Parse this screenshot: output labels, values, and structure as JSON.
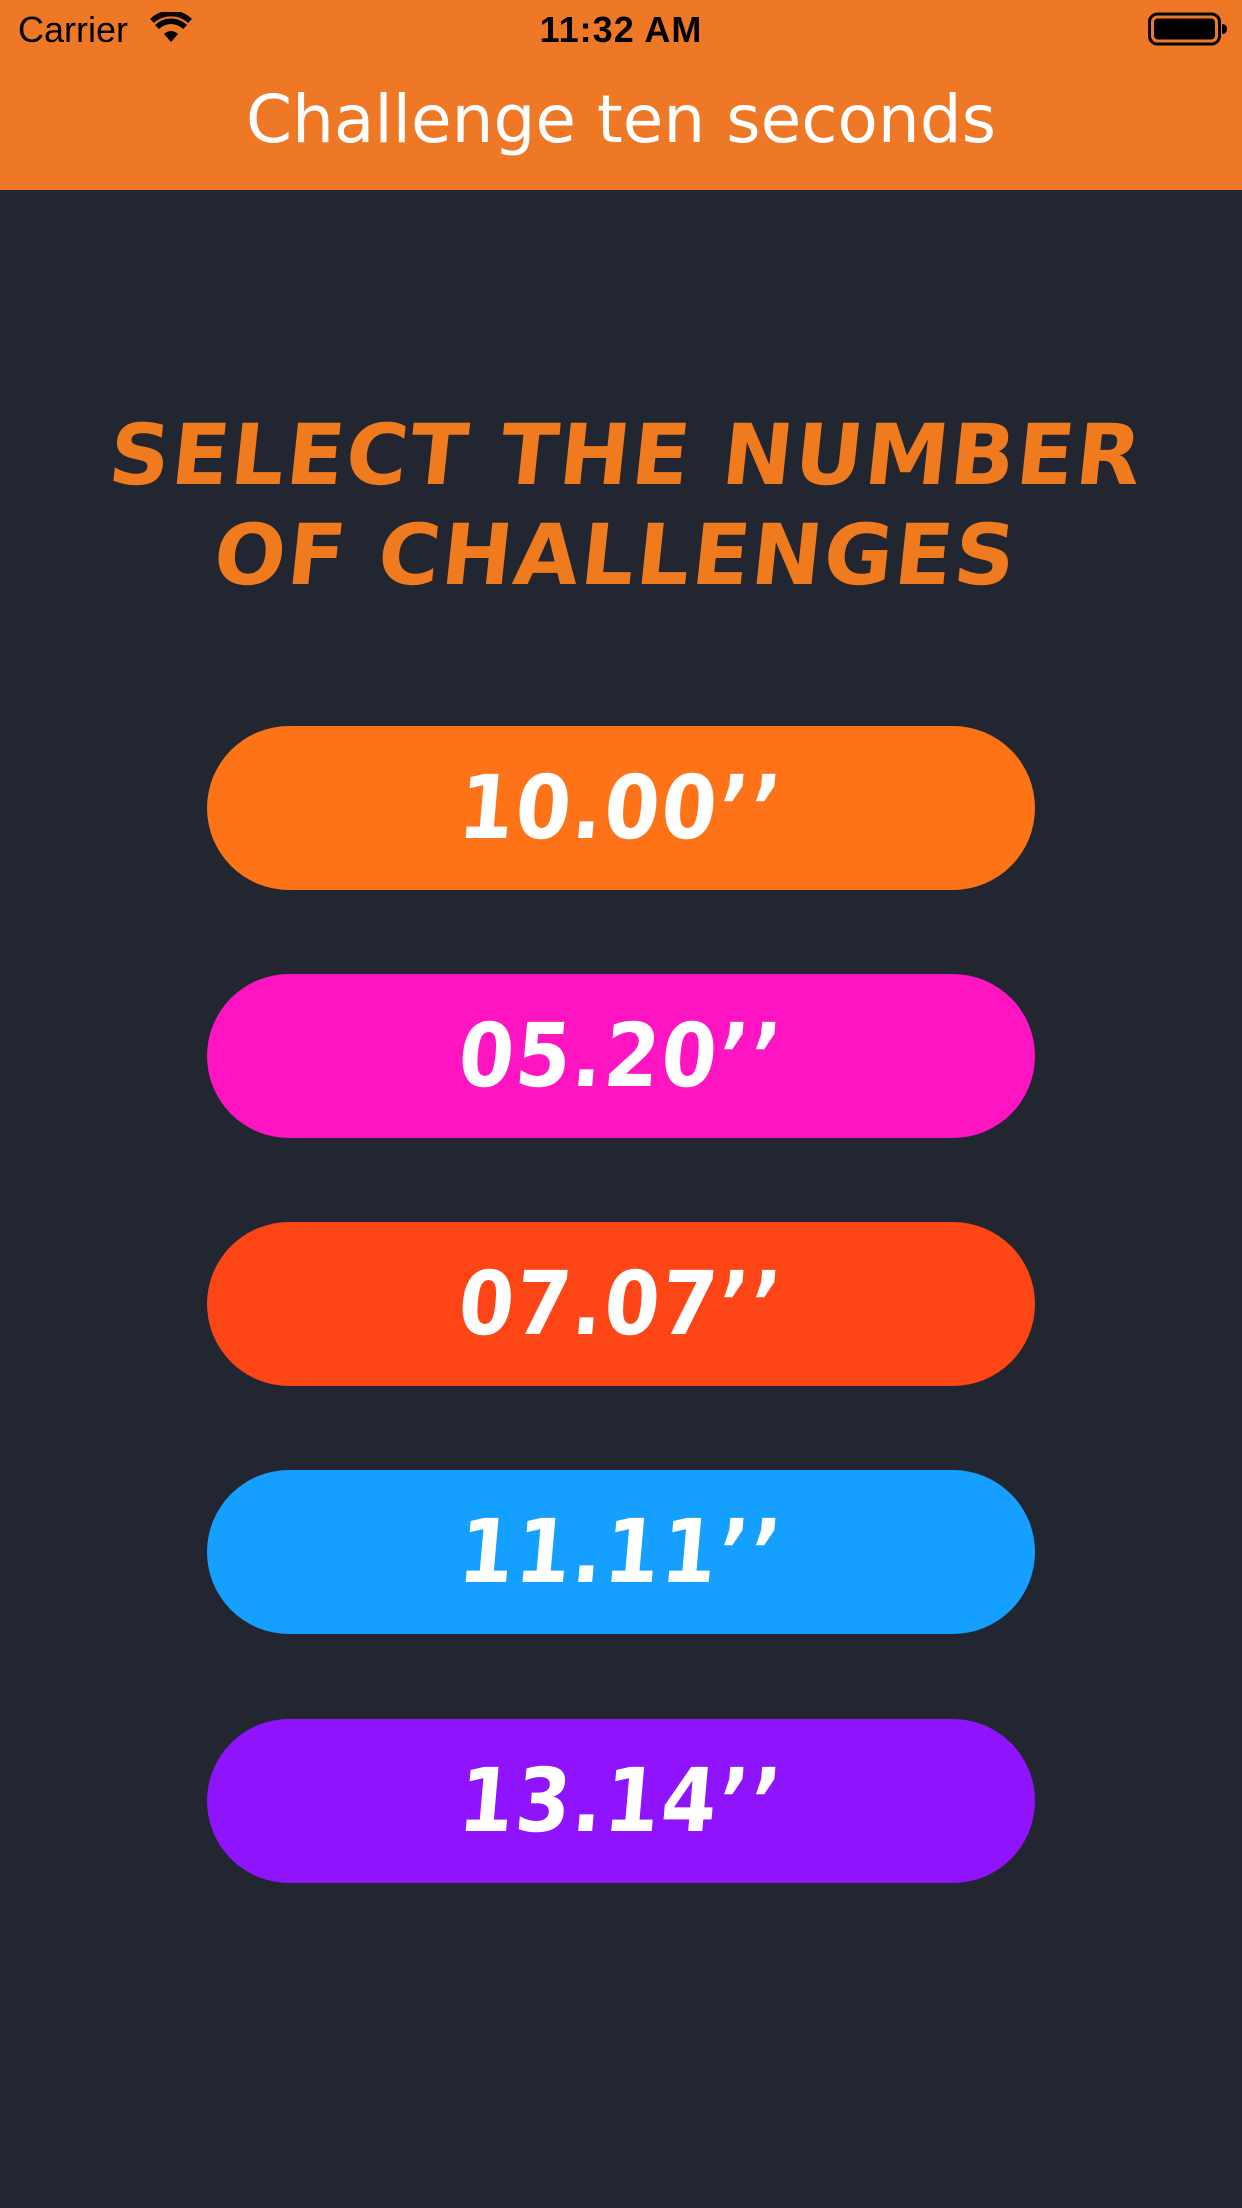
{
  "status_bar": {
    "carrier": "Carrier",
    "time": "11:32 AM",
    "wifi_icon": "wifi-icon",
    "battery_icon": "battery-icon"
  },
  "nav": {
    "title": "Challenge ten seconds",
    "background_color": "#ee7826"
  },
  "heading": {
    "line1": "SELECT THE NUMBER",
    "line2": "OF CHALLENGES",
    "color": "#f07a1e"
  },
  "choices": [
    {
      "label": "10.00’’",
      "color": "#fe7318"
    },
    {
      "label": "05.20’’",
      "color": "#fe14c1"
    },
    {
      "label": "07.07’’",
      "color": "#fe4515"
    },
    {
      "label": "11.11’’",
      "color": "#159ffe"
    },
    {
      "label": "13.14’’",
      "color": "#9013fe"
    }
  ],
  "background_color": "#212630"
}
